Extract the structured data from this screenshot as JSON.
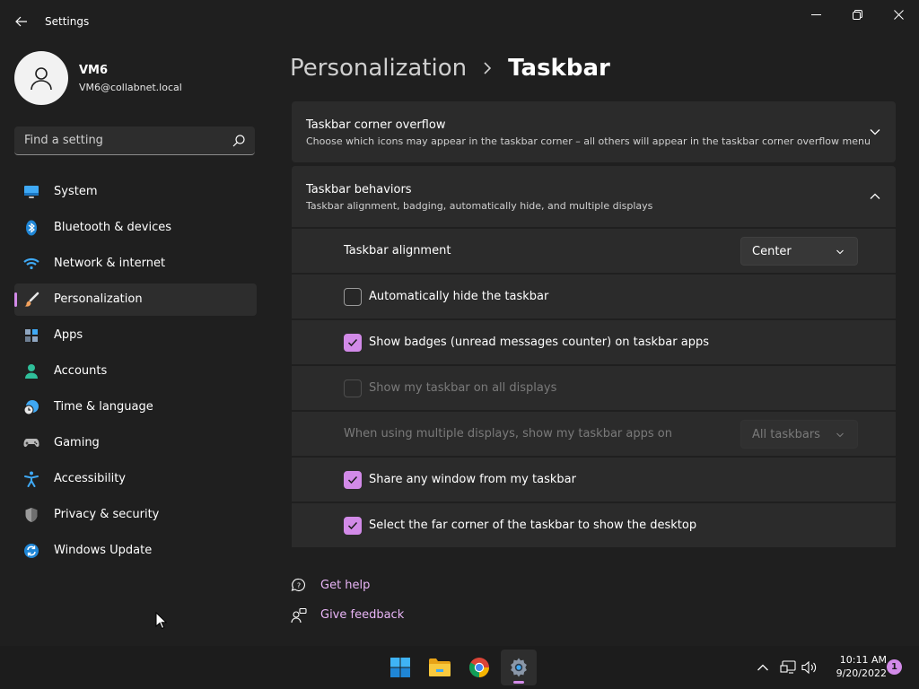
{
  "app": {
    "title": "Settings"
  },
  "colors": {
    "accent": "#d28ae8",
    "background": "#1f1f1f",
    "card": "#2b2b2b"
  },
  "profile": {
    "name": "VM6",
    "email": "VM6@collabnet.local"
  },
  "search": {
    "placeholder": "Find a setting"
  },
  "sidebar": {
    "items": [
      {
        "label": "System",
        "icon": "monitor-icon"
      },
      {
        "label": "Bluetooth & devices",
        "icon": "bluetooth-icon"
      },
      {
        "label": "Network & internet",
        "icon": "wifi-icon"
      },
      {
        "label": "Personalization",
        "icon": "paintbrush-icon",
        "active": true
      },
      {
        "label": "Apps",
        "icon": "apps-icon"
      },
      {
        "label": "Accounts",
        "icon": "person-icon"
      },
      {
        "label": "Time & language",
        "icon": "clock-globe-icon"
      },
      {
        "label": "Gaming",
        "icon": "gamepad-icon"
      },
      {
        "label": "Accessibility",
        "icon": "accessibility-icon"
      },
      {
        "label": "Privacy & security",
        "icon": "shield-icon"
      },
      {
        "label": "Windows Update",
        "icon": "update-icon"
      }
    ]
  },
  "breadcrumb": {
    "parent": "Personalization",
    "current": "Taskbar"
  },
  "corner_overflow": {
    "title": "Taskbar corner overflow",
    "subtitle": "Choose which icons may appear in the taskbar corner – all others will appear in the taskbar corner overflow menu"
  },
  "behaviors": {
    "title": "Taskbar behaviors",
    "subtitle": "Taskbar alignment, badging, automatically hide, and multiple displays",
    "alignment": {
      "label": "Taskbar alignment",
      "value": "Center"
    },
    "auto_hide": {
      "label": "Automatically hide the taskbar",
      "checked": false
    },
    "badges": {
      "label": "Show badges (unread messages counter) on taskbar apps",
      "checked": true
    },
    "all_displays": {
      "label": "Show my taskbar on all displays",
      "checked": false,
      "disabled": true
    },
    "multi_display": {
      "label": "When using multiple displays, show my taskbar apps on",
      "value": "All taskbars",
      "disabled": true
    },
    "share_window": {
      "label": "Share any window from my taskbar",
      "checked": true
    },
    "far_corner": {
      "label": "Select the far corner of the taskbar to show the desktop",
      "checked": true
    }
  },
  "help": {
    "get_help": "Get help",
    "feedback": "Give feedback"
  },
  "taskbar": {
    "apps": [
      "windows-start-icon",
      "file-explorer-icon",
      "chrome-icon",
      "settings-icon"
    ],
    "time": "10:11 AM",
    "date": "9/20/2022",
    "notifications": "1"
  }
}
